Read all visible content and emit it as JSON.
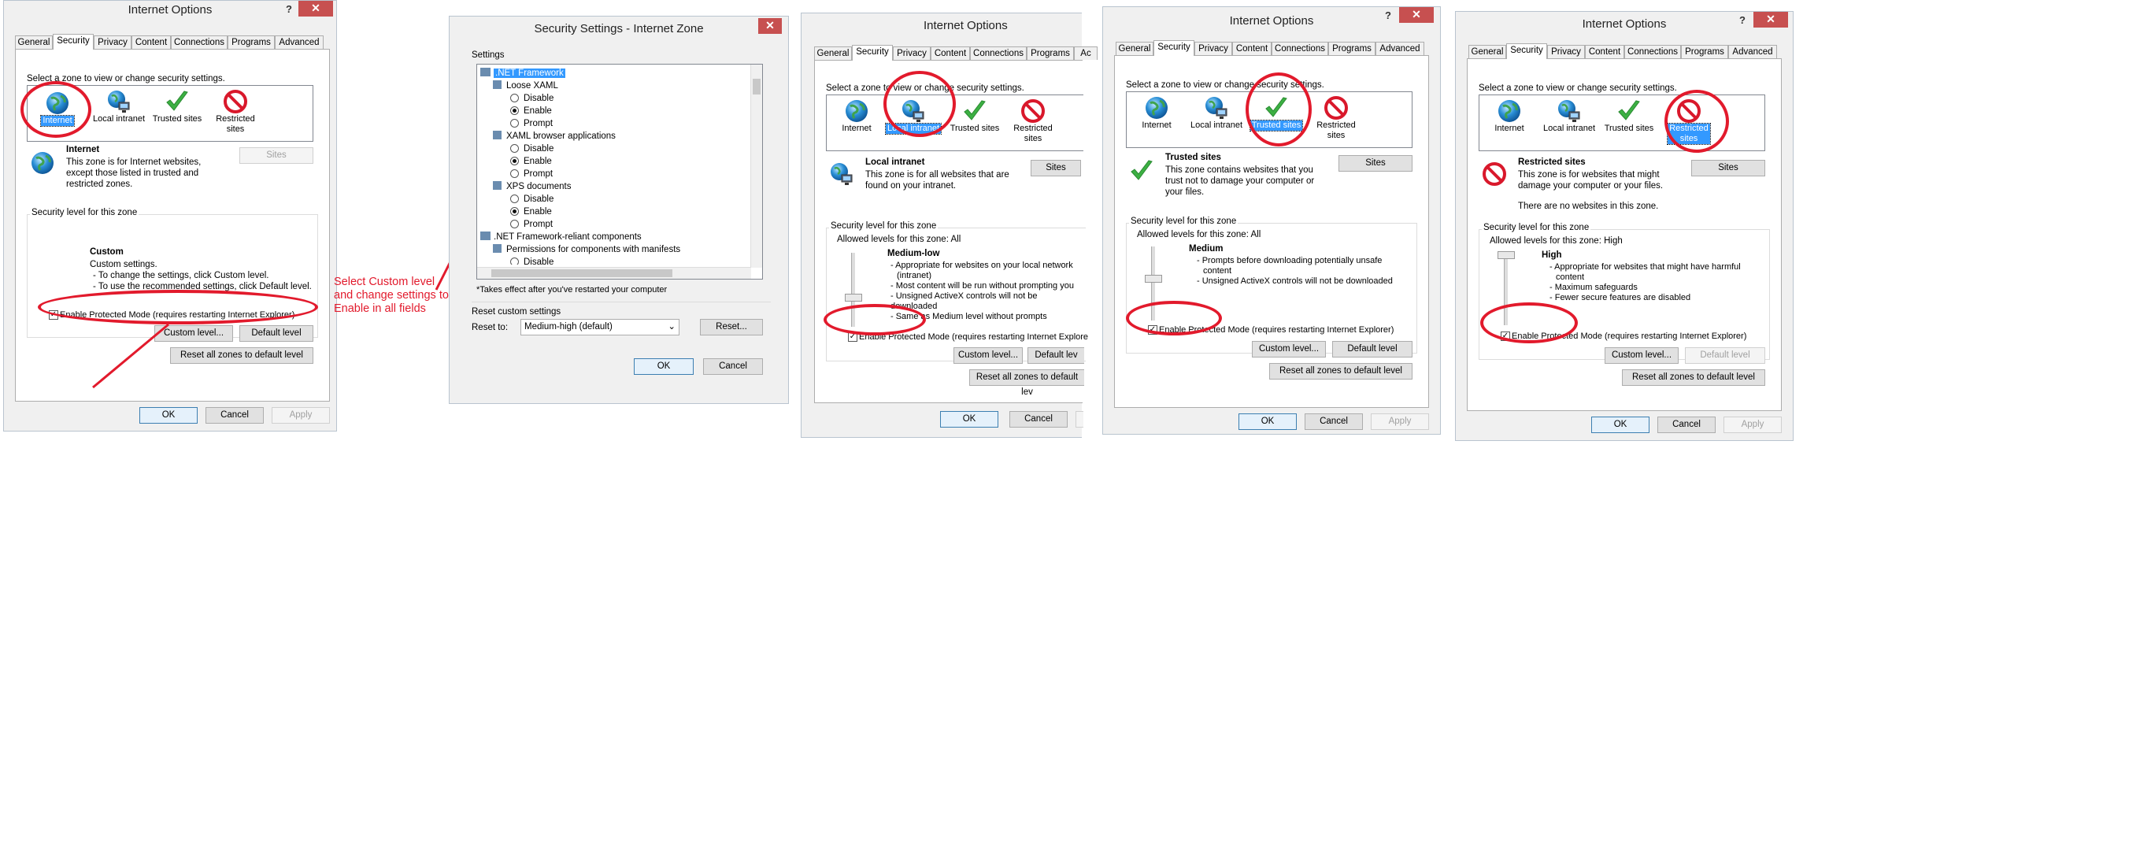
{
  "dialog_title": "Internet Options",
  "help_glyph": "?",
  "close_glyph": "✕",
  "tabs": [
    "General",
    "Security",
    "Privacy",
    "Content",
    "Connections",
    "Programs",
    "Advanced"
  ],
  "select_zone_prompt": "Select a zone to view or change security settings.",
  "zones": {
    "internet": "Internet",
    "local_intranet": "Local intranet",
    "trusted_sites": "Trusted sites",
    "restricted_line1": "Restricted",
    "restricted_line2": "sites"
  },
  "buttons": {
    "sites": "Sites",
    "custom_level": "Custom level...",
    "default_level": "Default level",
    "reset_all": "Reset all zones to default level",
    "ok": "OK",
    "cancel": "Cancel",
    "apply": "Apply"
  },
  "security_level_label": "Security level for this zone",
  "protected_mode_label": "Enable Protected Mode (requires restarting Internet Explorer)",
  "window1": {
    "zone_name": "Internet",
    "zone_desc": [
      "This zone is for Internet websites,",
      "except those listed in trusted and",
      "restricted zones."
    ],
    "level_title": "Custom",
    "level_lines": [
      "Custom settings.",
      "- To change the settings, click Custom level.",
      "- To use the recommended settings, click Default level."
    ],
    "custom_level_partial": "Custom level..."
  },
  "annotation": [
    "Select Custom level",
    "and change settings to",
    "Enable in all fields"
  ],
  "window2": {
    "title": "Security Settings - Internet Zone",
    "settings_label": "Settings",
    "tree": [
      ".NET Framework",
      "Loose XAML",
      "Disable",
      "Enable",
      "Prompt",
      "XAML browser applications",
      "Disable",
      "Enable",
      "Prompt",
      "XPS documents",
      "Disable",
      "Enable",
      "Prompt",
      ".NET Framework-reliant components",
      "Permissions for components with manifests",
      "Disable"
    ],
    "restart_note": "*Takes effect after you've restarted your computer",
    "reset_custom_label": "Reset custom settings",
    "reset_to_label": "Reset to:",
    "reset_to_value": "Medium-high (default)",
    "reset_button": "Reset...",
    "ok": "OK",
    "cancel": "Cancel"
  },
  "window3": {
    "zone_name": "Local intranet",
    "zone_desc": [
      "This zone is for all websites that are",
      "found on your intranet."
    ],
    "allowed_levels": "Allowed levels for this zone: All",
    "level_title": "Medium-low",
    "level_lines": [
      "- Appropriate for websites on your local network",
      "(intranet)",
      "- Most content will be run without prompting you",
      "- Unsigned ActiveX controls will not be downloaded",
      "- Same as Medium level without prompts"
    ],
    "protected_partial": "Enable Protected Mode (requires restarting Internet Explore",
    "default_partial": "Default lev",
    "reset_partial": "Reset all zones to default lev",
    "tab_partial": "Ac"
  },
  "window4": {
    "zone_name": "Trusted sites",
    "zone_desc": [
      "This zone contains websites that you",
      "trust not to damage your computer or",
      "your files."
    ],
    "allowed_levels": "Allowed levels for this zone: All",
    "level_title": "Medium",
    "level_lines": [
      "- Prompts before downloading potentially unsafe",
      "content",
      "- Unsigned ActiveX controls will not be downloaded"
    ]
  },
  "window5": {
    "zone_name": "Restricted sites",
    "zone_desc": [
      "This zone is for websites that might",
      "damage your computer or your files."
    ],
    "no_sites": "There are no websites in this zone.",
    "allowed_levels": "Allowed levels for this zone: High",
    "level_title": "High",
    "level_lines": [
      "- Appropriate for websites that might have harmful",
      "content",
      "- Maximum safeguards",
      "- Fewer secure features are disabled"
    ]
  },
  "colors": {
    "annotation_red": "#e21a2c",
    "selection_blue": "#3399ff",
    "close_red": "#c75050"
  }
}
